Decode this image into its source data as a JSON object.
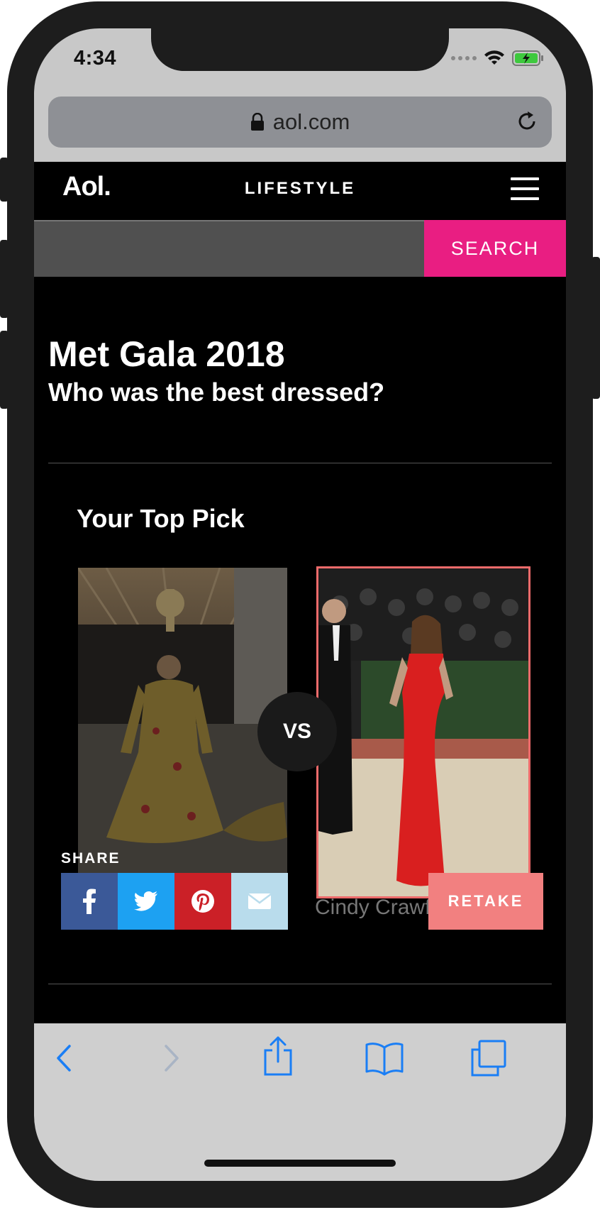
{
  "status_bar": {
    "time": "4:34"
  },
  "browser": {
    "url": "aol.com"
  },
  "site": {
    "logo": "Aol.",
    "section": "LIFESTYLE",
    "search_button": "SEARCH",
    "search_placeholder": ""
  },
  "article": {
    "title": "Met Gala 2018",
    "subtitle": "Who was the best dressed?"
  },
  "quiz": {
    "top_pick_heading": "Your Top Pick",
    "vs_label": "VS",
    "share_label": "SHARE",
    "selected_caption": "Cindy Crawford",
    "retake_label": "RETAKE"
  },
  "colors": {
    "search_accent": "#e91e82",
    "retake": "#f28080",
    "facebook": "#3b5998",
    "twitter": "#1da1f2",
    "pinterest": "#cb2027",
    "email": "#b9dcec",
    "ios_blue": "#1a7ef5"
  },
  "icons": {
    "share": [
      "facebook-icon",
      "twitter-icon",
      "pinterest-icon",
      "email-icon"
    ],
    "toolbar": [
      "back-icon",
      "forward-icon",
      "share-icon",
      "bookmarks-icon",
      "tabs-icon"
    ]
  }
}
